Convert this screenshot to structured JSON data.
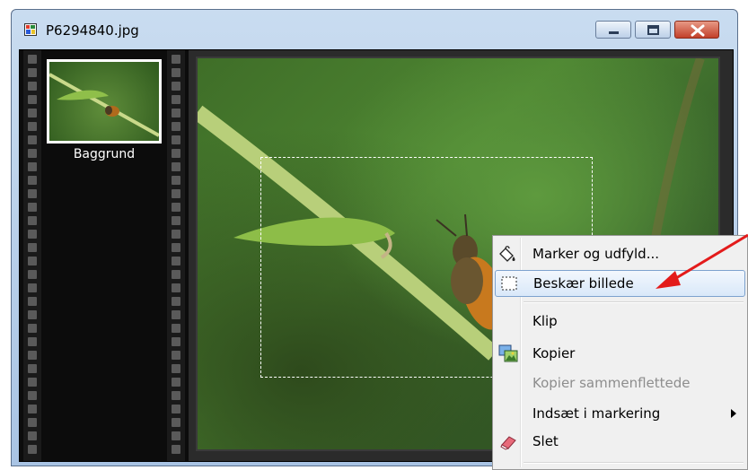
{
  "window": {
    "title": "P6294840.jpg",
    "minimize_icon": "minimize-icon",
    "maximize_icon": "maximize-icon",
    "close_icon": "close-icon"
  },
  "filmstrip": {
    "layers": [
      {
        "label": "Baggrund",
        "selected": true
      }
    ]
  },
  "context_menu": {
    "items": [
      {
        "label": "Marker og udfyld...",
        "icon": "fill-selection-icon",
        "enabled": true
      },
      {
        "label": "Beskær billede",
        "icon": "crop-icon",
        "enabled": true,
        "highlighted": true
      },
      {
        "label": "Klip",
        "icon": "",
        "enabled": true
      },
      {
        "label": "Kopier",
        "icon": "copy-image-icon",
        "enabled": true
      },
      {
        "label": "Kopier sammenflettede",
        "icon": "",
        "enabled": false
      },
      {
        "label": "Indsæt i markering",
        "icon": "",
        "enabled": true,
        "submenu": true
      },
      {
        "label": "Slet",
        "icon": "eraser-icon",
        "enabled": true
      }
    ]
  },
  "colors": {
    "menu_highlight_border": "#7da2ce",
    "annotation_arrow": "#e31b1b",
    "close_button": "#c2402a"
  }
}
